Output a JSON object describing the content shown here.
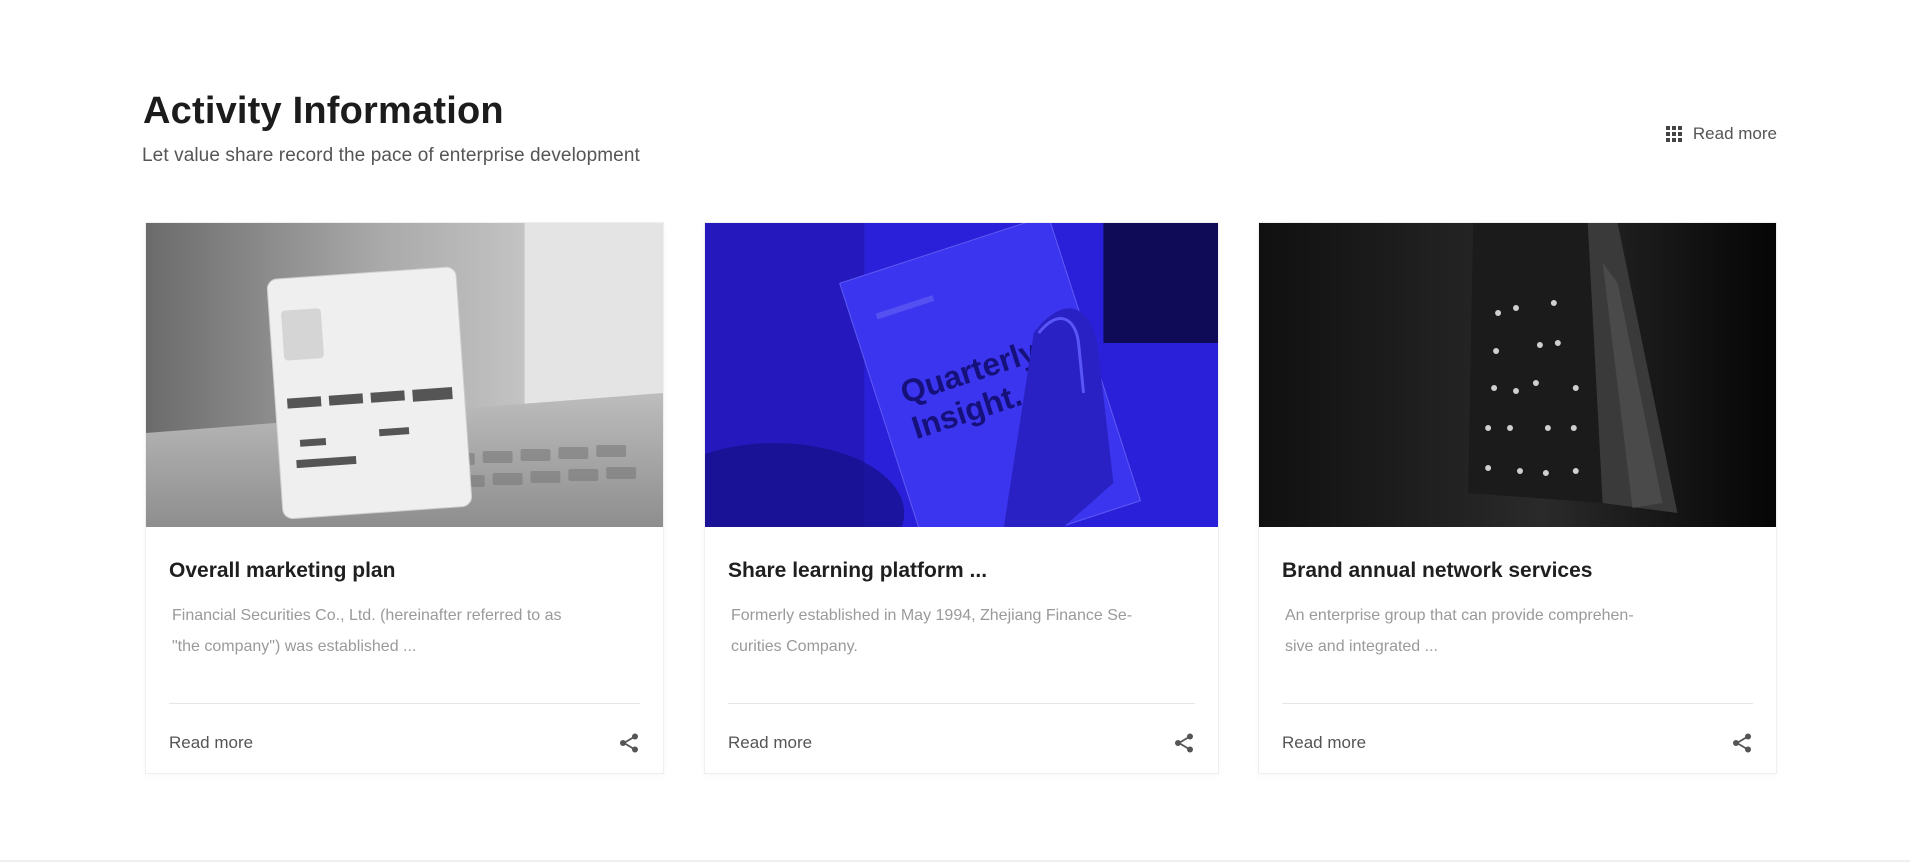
{
  "section": {
    "title": "Activity Information",
    "subtitle": "Let value share record the pace of enterprise development",
    "read_more_label": "Read more",
    "read_more_icon": "grid-icon"
  },
  "cards": [
    {
      "title": "Overall marketing plan",
      "description": "Financial Securities Co., Ltd. (hereinafter referred to as\n\"the company\") was established ...",
      "read_more_label": "Read more",
      "share_icon": "share-icon",
      "image_tone": "#b9b9b9"
    },
    {
      "title": "Share learning platform ...",
      "description": "Formerly established in May 1994, Zhejiang Finance Se-\ncurities Company.",
      "read_more_label": "Read more",
      "share_icon": "share-icon",
      "image_tone": "#2a1fd8",
      "image_text": "Quarterly Insight"
    },
    {
      "title": "Brand annual network services",
      "description": "An enterprise group that can provide comprehen-\nsive and integrated ...",
      "read_more_label": "Read more",
      "share_icon": "share-icon",
      "image_tone": "#0d0d0d"
    }
  ],
  "colors": {
    "title": "#1c1c1c",
    "subtitle": "#555555",
    "muted_text": "#9a9a9a",
    "accent_blue": "#2a1fd8"
  }
}
